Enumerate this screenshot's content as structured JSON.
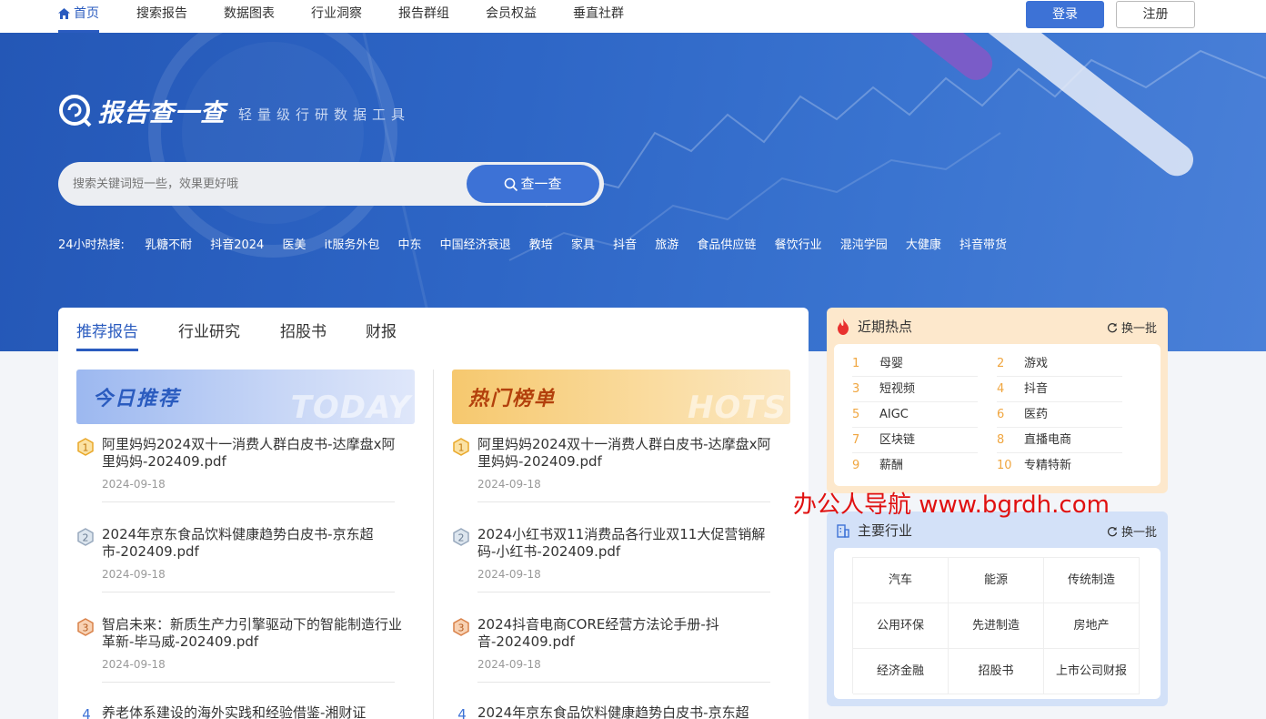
{
  "nav": {
    "items": [
      "首页",
      "搜索报告",
      "数据图表",
      "行业洞察",
      "报告群组",
      "会员权益",
      "垂直社群"
    ],
    "login": "登录",
    "register": "注册"
  },
  "hero": {
    "logo_title": "报告查一查",
    "slogan": "轻量级行研数据工具",
    "search_placeholder": "搜索关键词短一些，效果更好哦",
    "search_button": "查一查",
    "hot_label": "24小时热搜:",
    "hot_terms": [
      "乳糖不耐",
      "抖音2024",
      "医美",
      "it服务外包",
      "中东",
      "中国经济衰退",
      "教培",
      "家具",
      "抖音",
      "旅游",
      "食品供应链",
      "餐饮行业",
      "混沌学园",
      "大健康",
      "抖音带货"
    ]
  },
  "tabs": [
    "推荐报告",
    "行业研究",
    "招股书",
    "财报"
  ],
  "banners": {
    "today_title": "今日推荐",
    "today_watermark": "TODAY",
    "hots_title": "热门榜单",
    "hots_watermark": "HOTS"
  },
  "reports_left": [
    {
      "rank": "1",
      "title": "阿里妈妈2024双十一消费人群白皮书-达摩盘x阿里妈妈-202409.pdf",
      "date": "2024-09-18"
    },
    {
      "rank": "2",
      "title": "2024年京东食品饮料健康趋势白皮书-京东超市-202409.pdf",
      "date": "2024-09-18"
    },
    {
      "rank": "3",
      "title": "智启未来：新质生产力引擎驱动下的智能制造行业革新-毕马威-202409.pdf",
      "date": "2024-09-18"
    },
    {
      "rank": "4",
      "title": "养老体系建设的海外实践和经验借鉴-湘财证",
      "date": ""
    }
  ],
  "reports_right": [
    {
      "rank": "1",
      "title": "阿里妈妈2024双十一消费人群白皮书-达摩盘x阿里妈妈-202409.pdf",
      "date": "2024-09-18"
    },
    {
      "rank": "2",
      "title": "2024小红书双11消费品各行业双11大促营销解码-小红书-202409.pdf",
      "date": "2024-09-18"
    },
    {
      "rank": "3",
      "title": "2024抖音电商CORE经营方法论手册-抖音-202409.pdf",
      "date": "2024-09-18"
    },
    {
      "rank": "4",
      "title": "2024年京东食品饮料健康趋势白皮书-京东超",
      "date": ""
    }
  ],
  "hot_panel": {
    "title": "近期热点",
    "refresh": "换一批",
    "items": [
      {
        "num": "1",
        "text": "母婴"
      },
      {
        "num": "2",
        "text": "游戏"
      },
      {
        "num": "3",
        "text": "短视频"
      },
      {
        "num": "4",
        "text": "抖音"
      },
      {
        "num": "5",
        "text": "AIGC"
      },
      {
        "num": "6",
        "text": "医药"
      },
      {
        "num": "7",
        "text": "区块链"
      },
      {
        "num": "8",
        "text": "直播电商"
      },
      {
        "num": "9",
        "text": "薪酬"
      },
      {
        "num": "10",
        "text": "专精特新"
      }
    ]
  },
  "industry_panel": {
    "title": "主要行业",
    "refresh": "换一批",
    "items": [
      "汽车",
      "能源",
      "传统制造",
      "公用环保",
      "先进制造",
      "房地产",
      "经济金融",
      "招股书",
      "上市公司财报"
    ]
  },
  "watermark": "办公人导航  www.bgrdh.com",
  "colors": {
    "accent": "#3d72d6",
    "hot_num": "#f0a640",
    "watermark": "#e01010"
  }
}
